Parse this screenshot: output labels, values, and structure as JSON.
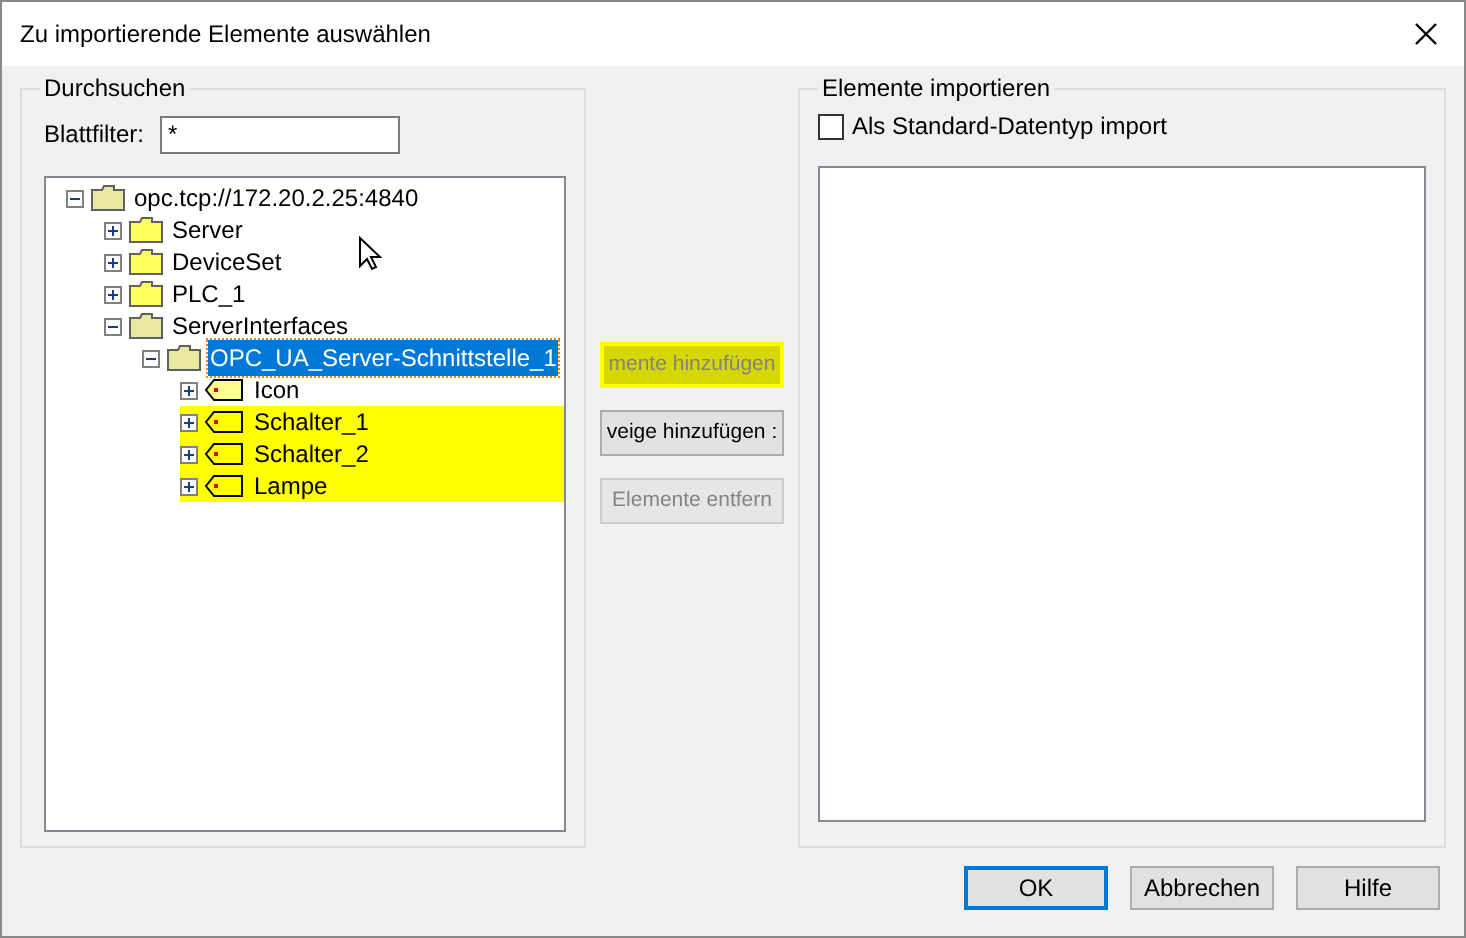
{
  "window": {
    "title": "Zu importierende Elemente auswählen"
  },
  "browse": {
    "title": "Durchsuchen",
    "filter_label": "Blattfilter:",
    "filter_value": "*",
    "tree": [
      {
        "label": "opc.tcp://172.20.2.25:4840",
        "kind": "folder",
        "expanded": true,
        "selected": false,
        "highlighted": false,
        "children": [
          {
            "label": "Server",
            "kind": "folder",
            "expanded": false,
            "selected": false,
            "highlighted": false
          },
          {
            "label": "DeviceSet",
            "kind": "folder",
            "expanded": false,
            "selected": false,
            "highlighted": false
          },
          {
            "label": "PLC_1",
            "kind": "folder",
            "expanded": false,
            "selected": false,
            "highlighted": false
          },
          {
            "label": "ServerInterfaces",
            "kind": "folder",
            "expanded": true,
            "selected": false,
            "highlighted": false,
            "children": [
              {
                "label": "OPC_UA_Server-Schnittstelle_1",
                "kind": "folder",
                "expanded": true,
                "selected": true,
                "highlighted": false,
                "children": [
                  {
                    "label": "Icon",
                    "kind": "tag",
                    "expanded": false,
                    "selected": false,
                    "highlighted": false
                  },
                  {
                    "label": "Schalter_1",
                    "kind": "tag",
                    "expanded": false,
                    "selected": false,
                    "highlighted": true
                  },
                  {
                    "label": "Schalter_2",
                    "kind": "tag",
                    "expanded": false,
                    "selected": false,
                    "highlighted": true
                  },
                  {
                    "label": "Lampe",
                    "kind": "tag",
                    "expanded": false,
                    "selected": false,
                    "highlighted": true
                  }
                ]
              }
            ]
          }
        ]
      }
    ]
  },
  "actions": [
    {
      "label": "mente hinzufügen",
      "disabled": true,
      "highlighted": true
    },
    {
      "label": "veige hinzufügen :",
      "disabled": false,
      "highlighted": false
    },
    {
      "label": "Elemente entfern",
      "disabled": true,
      "highlighted": false
    }
  ],
  "import": {
    "title": "Elemente importieren",
    "checkbox_label": "Als Standard-Datentyp import",
    "checked": false
  },
  "buttons": [
    {
      "label": "OK",
      "default": true
    },
    {
      "label": "Abbrechen",
      "default": false
    },
    {
      "label": "Hilfe",
      "default": false
    }
  ]
}
